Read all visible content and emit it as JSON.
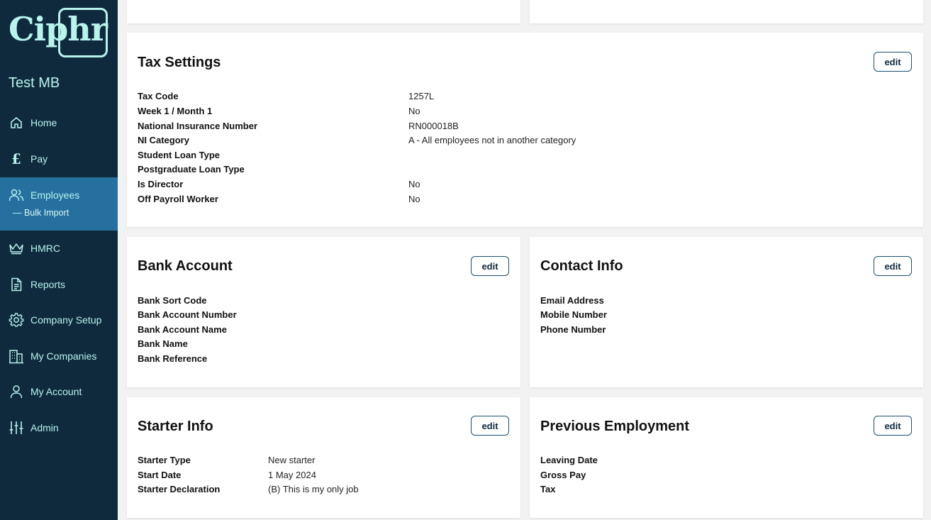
{
  "sidebar": {
    "logo_text": "Ciphr",
    "company_name": "Test MB",
    "items": [
      {
        "label": "Home",
        "icon": "home-icon"
      },
      {
        "label": "Pay",
        "icon": "pound-icon"
      },
      {
        "label": "Employees",
        "icon": "people-icon"
      },
      {
        "label": "HMRC",
        "icon": "crown-icon"
      },
      {
        "label": "Reports",
        "icon": "document-icon"
      },
      {
        "label": "Company Setup",
        "icon": "gear-icon"
      },
      {
        "label": "My Companies",
        "icon": "building-icon"
      },
      {
        "label": "My Account",
        "icon": "person-icon"
      },
      {
        "label": "Admin",
        "icon": "sliders-icon"
      }
    ],
    "sub_item": "— Bulk Import",
    "active": "Employees"
  },
  "tax_settings": {
    "title": "Tax Settings",
    "edit": "edit",
    "rows": [
      {
        "label": "Tax Code",
        "value": "1257L"
      },
      {
        "label": "Week 1 / Month 1",
        "value": "No"
      },
      {
        "label": "National Insurance Number",
        "value": "RN000018B"
      },
      {
        "label": "NI Category",
        "value": "A - All employees not in another category"
      },
      {
        "label": "Student Loan Type",
        "value": ""
      },
      {
        "label": "Postgraduate Loan Type",
        "value": ""
      },
      {
        "label": "Is Director",
        "value": "No"
      },
      {
        "label": "Off Payroll Worker",
        "value": "No"
      }
    ]
  },
  "bank_account": {
    "title": "Bank Account",
    "edit": "edit",
    "rows": [
      {
        "label": "Bank Sort Code",
        "value": ""
      },
      {
        "label": "Bank Account Number",
        "value": ""
      },
      {
        "label": "Bank Account Name",
        "value": ""
      },
      {
        "label": "Bank Name",
        "value": ""
      },
      {
        "label": "Bank Reference",
        "value": ""
      }
    ]
  },
  "contact_info": {
    "title": "Contact Info",
    "edit": "edit",
    "rows": [
      {
        "label": "Email Address",
        "value": ""
      },
      {
        "label": "Mobile Number",
        "value": ""
      },
      {
        "label": "Phone Number",
        "value": ""
      }
    ]
  },
  "starter_info": {
    "title": "Starter Info",
    "edit": "edit",
    "rows": [
      {
        "label": "Starter Type",
        "value": "New starter"
      },
      {
        "label": "Start Date",
        "value": "1 May 2024"
      },
      {
        "label": "Starter Declaration",
        "value": "(B) This is my only job"
      }
    ]
  },
  "previous_employment": {
    "title": "Previous Employment",
    "edit": "edit",
    "rows": [
      {
        "label": "Leaving Date",
        "value": ""
      },
      {
        "label": "Gross Pay",
        "value": ""
      },
      {
        "label": "Tax",
        "value": ""
      }
    ]
  },
  "colors": {
    "sidebar_bg": "#0f2a3d",
    "sidebar_active": "#2670a0",
    "sidebar_text": "#b8f3ec",
    "button_border": "#1d4f6e"
  }
}
